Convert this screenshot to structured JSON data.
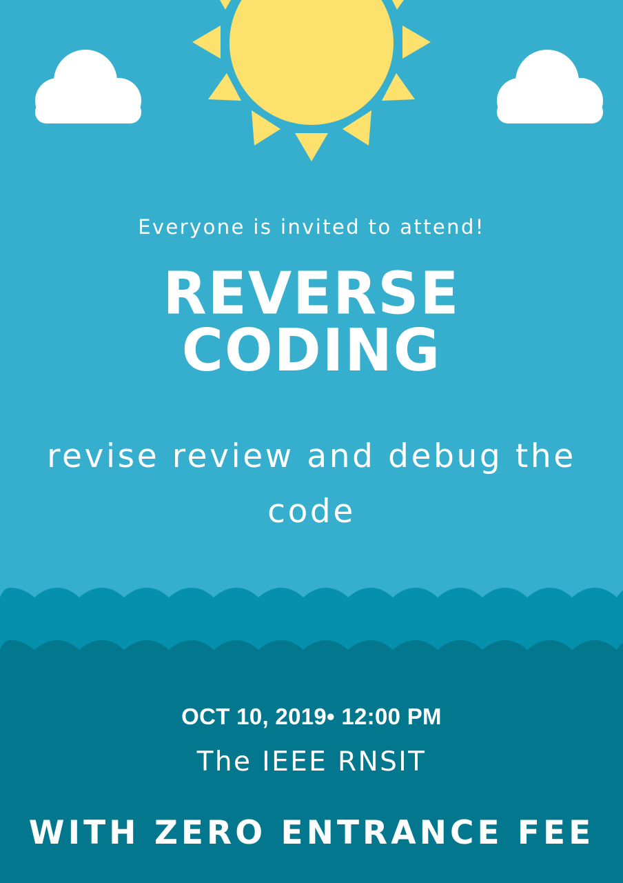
{
  "poster": {
    "invite": "Everyone is invited to attend!",
    "title_line1": "REVERSE",
    "title_line2": "CODING",
    "subtitle_line1": "revise review and debug the",
    "subtitle_line2": "code",
    "datetime": "OCT 10, 2019•  12:00 PM",
    "venue": "The IEEE RNSIT",
    "fee": "WITH ZERO ENTRANCE FEE"
  },
  "colors": {
    "sky": "#35afcd",
    "sun": "#fde16d",
    "cloud": "#ffffff",
    "wave_mid": "#0591ad",
    "wave_deep": "#02778e",
    "text": "#ffffff"
  },
  "icons": [
    "sun-icon",
    "cloud-icon"
  ]
}
